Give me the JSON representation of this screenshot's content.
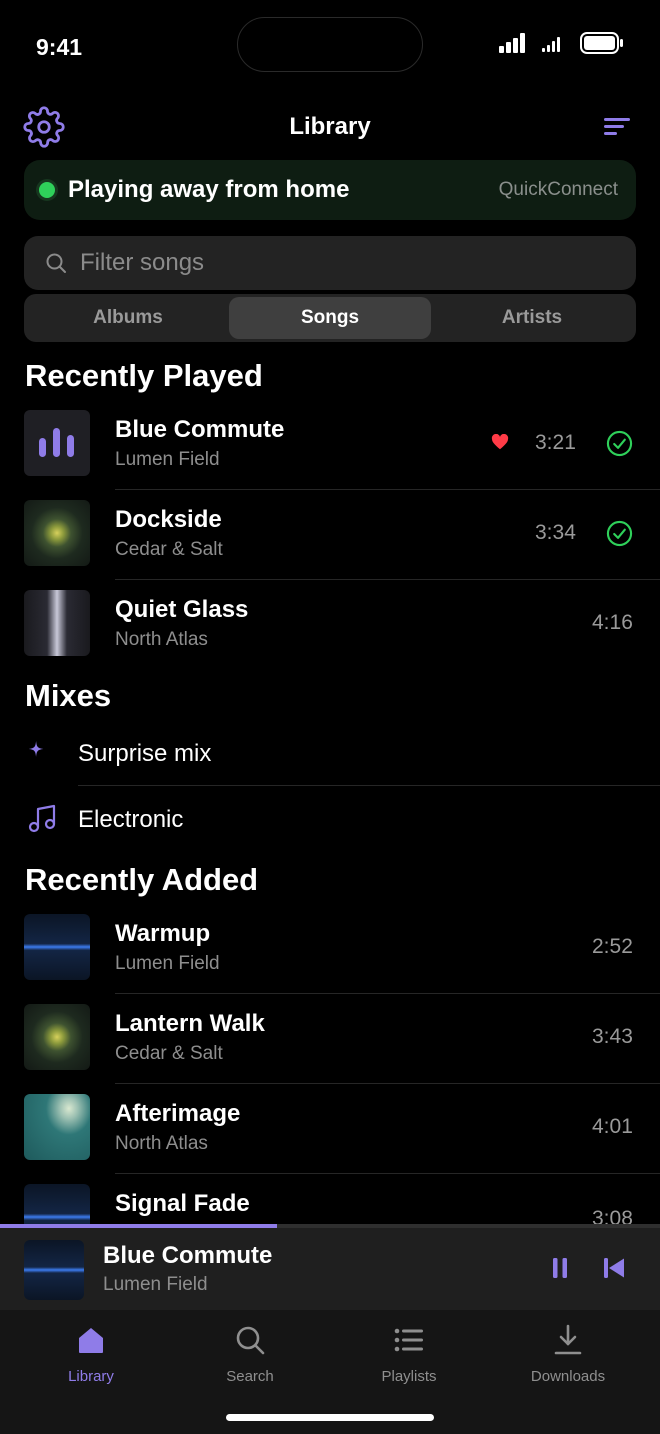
{
  "status": {
    "time": "9:41"
  },
  "nav": {
    "title": "Library"
  },
  "remote": {
    "status": "Playing away from home",
    "link": "QuickConnect"
  },
  "search": {
    "placeholder": "Filter songs",
    "value": ""
  },
  "segments": {
    "items": [
      "Albums",
      "Songs",
      "Artists"
    ],
    "selected": "Songs"
  },
  "recently_played": {
    "title": "Recently Played",
    "songs": [
      {
        "title": "Blue Commute",
        "artist": "Lumen Field",
        "duration": "3:21",
        "favorite": true,
        "downloaded": true,
        "art": "bars"
      },
      {
        "title": "Dockside",
        "artist": "Cedar & Salt",
        "duration": "3:34",
        "favorite": false,
        "downloaded": true,
        "art": "flower"
      },
      {
        "title": "Quiet Glass",
        "artist": "North Atlas",
        "duration": "4:16",
        "favorite": false,
        "downloaded": false,
        "art": "glass"
      }
    ]
  },
  "mixes": {
    "title": "Mixes",
    "items": [
      {
        "label": "Surprise mix",
        "icon": "sparkle-icon"
      },
      {
        "label": "Electronic",
        "icon": "music-note-icon"
      }
    ]
  },
  "recently_added": {
    "title": "Recently Added",
    "songs": [
      {
        "title": "Warmup",
        "artist": "Lumen Field",
        "duration": "2:52",
        "art": "line"
      },
      {
        "title": "Lantern Walk",
        "artist": "Cedar & Salt",
        "duration": "3:43",
        "art": "flower"
      },
      {
        "title": "Afterimage",
        "artist": "North Atlas",
        "duration": "4:01",
        "art": "teal"
      },
      {
        "title": "Signal Fade",
        "artist": "",
        "duration": "3:08",
        "art": "line"
      }
    ]
  },
  "now_playing": {
    "title": "Blue Commute",
    "artist": "Lumen Field",
    "progress": 0.42
  },
  "tabs": [
    {
      "label": "Library",
      "icon": "library-icon",
      "active": true
    },
    {
      "label": "Search",
      "icon": "search-icon",
      "active": false
    },
    {
      "label": "Playlists",
      "icon": "playlists-icon",
      "active": false
    },
    {
      "label": "Downloads",
      "icon": "download-icon",
      "active": false
    }
  ],
  "colors": {
    "accent": "#8f7ce8",
    "connected": "#2fd05a",
    "favorite": "#ff3b47",
    "downloaded": "#2fd05a"
  }
}
